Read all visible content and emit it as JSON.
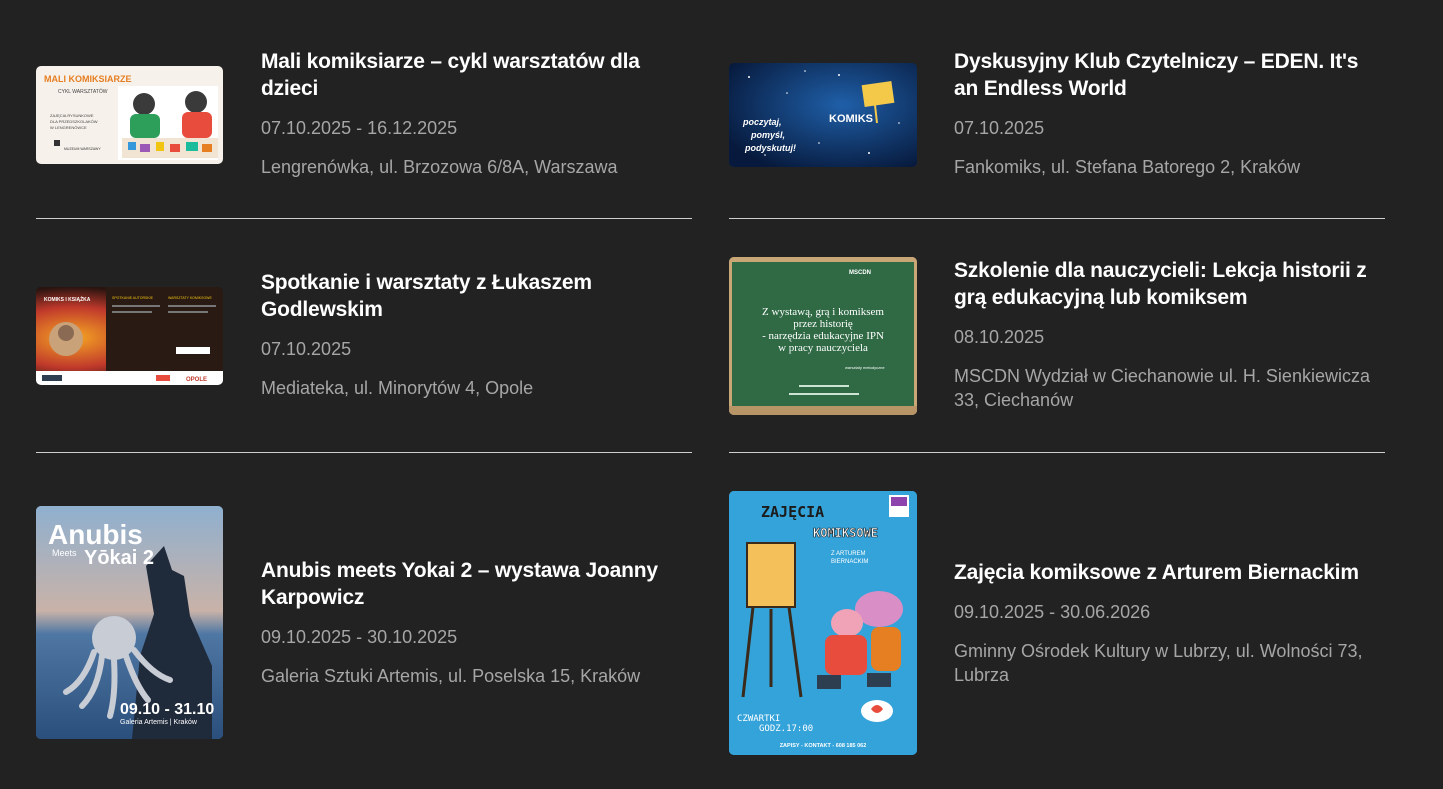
{
  "events": [
    {
      "title": "Mali komiksiarze – cykl warsztatów dla dzieci",
      "date": "07.10.2025 - 16.12.2025",
      "place": "Lengrenówka, ul. Brzozowa 6/8A, Warszawa",
      "thumb": {
        "line1": "MALI KOMIKSIARZE",
        "line2": "CYKL WARSZTATÓW",
        "line3": "ZAJĘCIA RYSUNKOWE",
        "line4": "DLA PRZEDSZKOLAKÓW",
        "line5": "W LENGRENÓWCE",
        "logo": "MUZEUM WARSZAWY"
      }
    },
    {
      "title": "Dyskusyjny Klub Czytelniczy – EDEN. It's an Endless World",
      "date": "07.10.2025",
      "place": "Fankomiks, ul. Stefana Batorego 2, Kraków",
      "thumb": {
        "line1": "poczytaj,",
        "line2": "pomyśl,",
        "line3": "podyskutuj!",
        "word": "KOMIKS"
      }
    },
    {
      "title": "Spotkanie i warsztaty z Łukaszem Godlewskim",
      "date": "07.10.2025",
      "place": "Mediateka, ul. Minorytów 4, Opole",
      "thumb": {
        "line1": "KOMIKS I KSIĄŻKA",
        "line2": "SPOTKANIE AUTORSKIE",
        "line3": "WARSZTATY KOMIKSOWE",
        "brand": "OPOLE"
      }
    },
    {
      "title": "Szkolenie dla nauczycieli: Lekcja historii z grą edukacyjną lub komiksem",
      "date": "08.10.2025",
      "place": "MSCDN Wydział w Ciechanowie ul. H. Sienkiewicza 33, Ciechanów",
      "thumb": {
        "brand": "MSCDN",
        "line1": "Z wystawą, grą i komiksem",
        "line2": "przez historię",
        "line3": "- narzędzia edukacyjne IPN",
        "line4": "w pracy nauczyciela",
        "line5": "warsztaty metodyczne"
      }
    },
    {
      "title": "Anubis meets Yokai 2 – wystawa Joanny Karpowicz",
      "date": "09.10.2025 - 30.10.2025",
      "place": "Galeria Sztuki Artemis, ul. Poselska 15, Kraków",
      "thumb": {
        "line1": "Anubis",
        "line2": "Meets",
        "line3": "Yōkai 2",
        "dates": "09.10 - 31.10",
        "venue": "Galeria Artemis | Kraków"
      }
    },
    {
      "title": "Zajęcia komiksowe z Arturem Biernackim",
      "date": "09.10.2025 - 30.06.2026",
      "place": "Gminny Ośrodek Kultury w Lubrzy, ul. Wolności 73, Lubrza",
      "thumb": {
        "line1": "ZAJĘCIA",
        "line2": "KOMIKSOWE",
        "line3": "Z ARTUREM",
        "line4": "BIERNACKIM",
        "line5": "CZWARTKI",
        "line6": "GODZ.17:00",
        "line7": "ZAPISY - KONTAKT - 608 185 062"
      }
    }
  ]
}
